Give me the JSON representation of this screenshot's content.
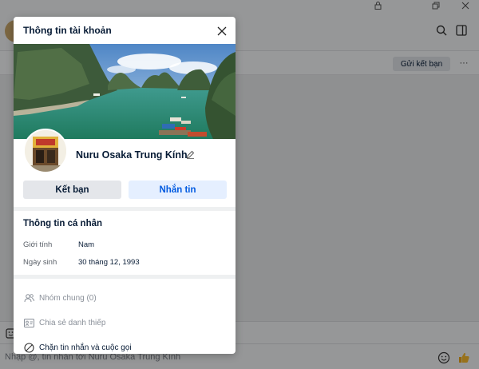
{
  "background": {
    "header_more_label": "···",
    "send_request_label": "Gửi kết bạn",
    "composer_placeholder": "Nhập @, tin nhắn tới Nuru Osaka Trung Kính"
  },
  "modal": {
    "title": "Thông tin tài khoản",
    "profile_name": "Nuru Osaka Trung Kính",
    "buttons": {
      "add_friend": "Kết bạn",
      "message": "Nhắn tin"
    },
    "personal_info": {
      "title": "Thông tin cá nhân",
      "rows": [
        {
          "label": "Giới tính",
          "value": "Nam"
        },
        {
          "label": "Ngày sinh",
          "value": "30 tháng 12, 1993"
        }
      ]
    },
    "actions": {
      "groups": "Nhóm chung (0)",
      "share_card": "Chia sẻ danh thiếp",
      "block": "Chặn tin nhắn và cuộc gọi"
    }
  },
  "colors": {
    "accent_blue": "#005ae0",
    "accent_blue_bg": "#e5efff",
    "text_dark": "#081c36"
  },
  "icons": [
    "lock-icon",
    "restore-icon",
    "close-icon",
    "search-icon",
    "sidebar-toggle-icon",
    "pencil-icon",
    "users-icon",
    "contact-card-icon",
    "block-icon",
    "emoji-icon",
    "thumbs-up-icon",
    "sticker-icon"
  ]
}
